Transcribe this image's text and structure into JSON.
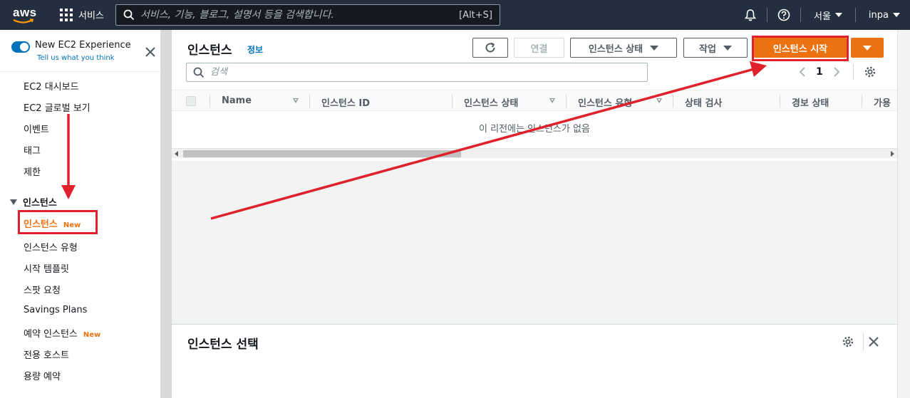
{
  "topbar": {
    "logo_text": "aws",
    "services_label": "서비스",
    "search_placeholder": "서비스, 기능, 블로그, 설명서 등을 검색합니다.",
    "search_shortcut": "[Alt+S]",
    "region_label": "서울",
    "user_label": "inpa"
  },
  "sidebar": {
    "experience_title": "New EC2 Experience",
    "experience_sub": "Tell us what you think",
    "items_top": [
      "EC2 대시보드",
      "EC2 글로벌 보기",
      "이벤트",
      "태그",
      "제한"
    ],
    "section_label": "인스턴스",
    "section_items": [
      {
        "label": "인스턴스",
        "badge": "New",
        "active": true
      },
      {
        "label": "인스턴스 유형",
        "badge": ""
      },
      {
        "label": "시작 템플릿",
        "badge": ""
      },
      {
        "label": "스팟 요청",
        "badge": ""
      },
      {
        "label": "Savings Plans",
        "badge": ""
      },
      {
        "label": "예약 인스턴스",
        "badge": "New"
      },
      {
        "label": "전용 호스트",
        "badge": ""
      },
      {
        "label": "용량 예약",
        "badge": ""
      }
    ]
  },
  "main": {
    "title": "인스턴스",
    "info_link": "정보",
    "connect_label": "연결",
    "instance_state_label": "인스턴스 상태",
    "actions_label": "작업",
    "launch_label": "인스턴스 시작",
    "filter_placeholder": "검색",
    "page_number": "1",
    "columns": [
      "Name",
      "인스턴스 ID",
      "인스턴스 상태",
      "인스턴스 유형",
      "상태 검사",
      "경보 상태",
      "가용"
    ],
    "empty_message": "이 리전에는 인스턴스가 없음"
  },
  "bottom_panel": {
    "title": "인스턴스 선택"
  },
  "colors": {
    "topbar_bg": "#232f3e",
    "accent_orange": "#ec7211",
    "link_blue": "#0073bb",
    "annotation_red": "#e0202a"
  }
}
